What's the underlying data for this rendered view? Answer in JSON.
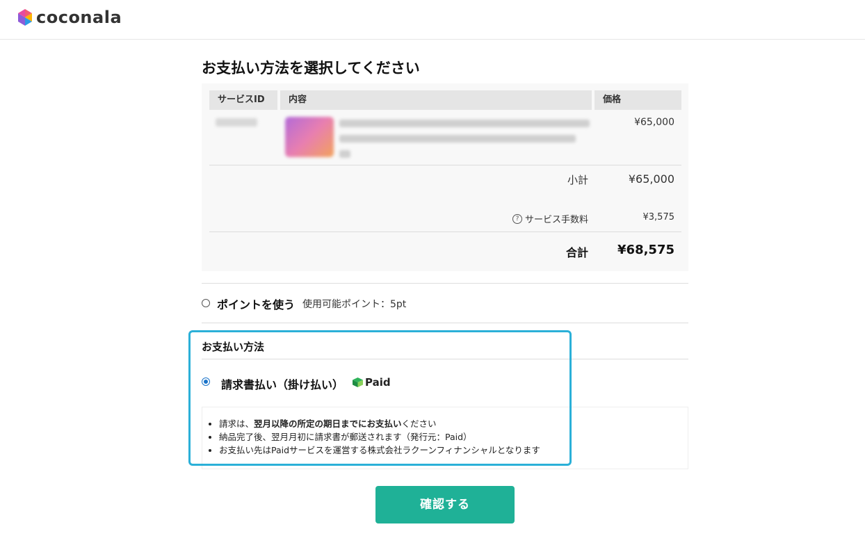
{
  "header": {
    "brand": "coconala"
  },
  "page_title": "お支払い方法を選択してください",
  "order_table": {
    "headers": [
      "サービスID",
      "内容",
      "価格"
    ],
    "row": {
      "price": "¥65,000"
    },
    "subtotal_label": "小計",
    "subtotal_value": "¥65,000",
    "fee_label": "サービス手数料",
    "fee_value": "¥3,575",
    "total_label": "合計",
    "total_value": "¥68,575"
  },
  "points": {
    "label": "ポイントを使う",
    "available": "使用可能ポイント：5pt"
  },
  "payment_method": {
    "heading": "お支払い方法",
    "option_label": "請求書払い（掛け払い）",
    "provider": "Paid",
    "notes": {
      "n1_a": "請求は、",
      "n1_b": "翌月以降の所定の期日までにお支払い",
      "n1_c": "ください",
      "n2": "納品完了後、翌月月初に請求書が郵送されます（発行元：Paid）",
      "n3": "お支払い先はPaidサービスを運営する株式会社ラクーンフィナンシャルとなります"
    }
  },
  "confirm_button": "確認する",
  "colors": {
    "accent": "#1fb197",
    "highlight": "#2bb0d8",
    "radio": "#1a73c9"
  }
}
